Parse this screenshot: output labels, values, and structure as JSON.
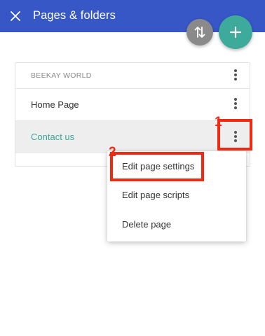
{
  "header": {
    "title": "Pages & folders",
    "close_icon": "close-icon",
    "background": "#3757c6"
  },
  "fabs": {
    "sort_icon": "sort-arrows-icon",
    "add_icon": "plus-icon",
    "sort_color": "#8a8a8a",
    "add_color": "#3daa9c"
  },
  "panel": {
    "site_name": "BEEKAY WORLD",
    "pages": [
      {
        "label": "Home Page",
        "selected": false
      },
      {
        "label": "Contact us",
        "selected": true
      }
    ],
    "more_icon": "more-vert-icon"
  },
  "context_menu": {
    "items": [
      "Edit page settings",
      "Edit page scripts",
      "Delete page"
    ]
  },
  "annotations": {
    "step_1": "1",
    "step_2": "2",
    "color": "#f02a12"
  }
}
